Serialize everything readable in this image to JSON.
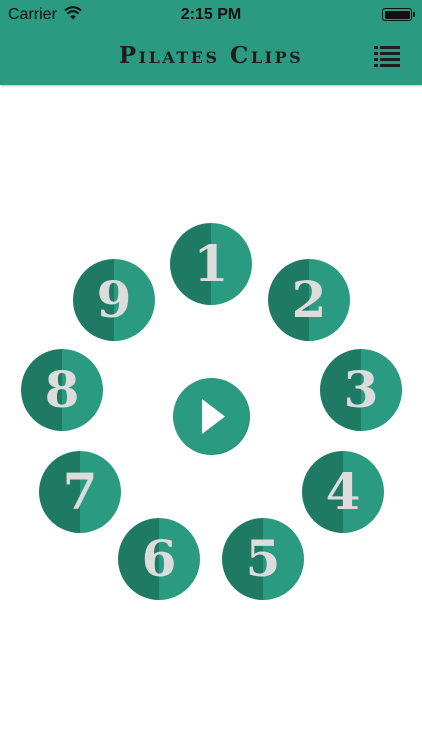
{
  "status_bar": {
    "carrier": "Carrier",
    "time": "2:15 PM"
  },
  "header": {
    "title": "Pilates Clips",
    "menu_icon": "list-icon"
  },
  "clips": [
    "1",
    "2",
    "3",
    "4",
    "5",
    "6",
    "7",
    "8",
    "9"
  ],
  "play_icon": "play-icon",
  "colors": {
    "accent": "#2a9b80",
    "accent_dark": "#1e7a63",
    "number": "#dcdcdc",
    "title_text": "#1e1e1e"
  }
}
